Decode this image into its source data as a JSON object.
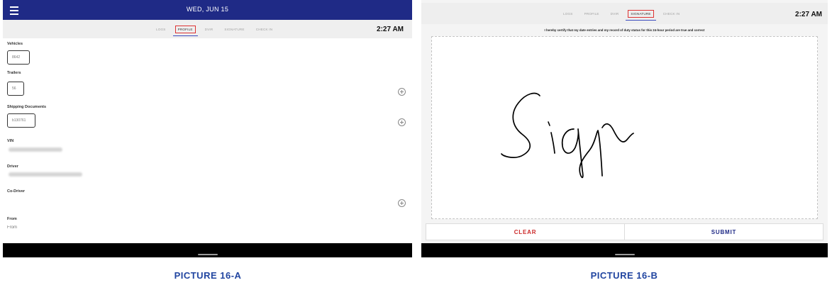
{
  "panel_a": {
    "topbar": {
      "date": "WED, JUN 15",
      "menu_icon": "hamburger-menu-icon",
      "theme_icon": "moon-icon"
    },
    "tabs": [
      {
        "label": "LOGS",
        "active": false
      },
      {
        "label": "PROFILE",
        "active": true
      },
      {
        "label": "DVIR",
        "active": false
      },
      {
        "label": "SIGNATURE",
        "active": false
      },
      {
        "label": "CHECK IN",
        "active": false
      }
    ],
    "time": "2:27 AM",
    "vehicles": {
      "label": "Vehicles",
      "value": "8642"
    },
    "trailers": {
      "label": "Trailers",
      "value": "56"
    },
    "shipping": {
      "label": "Shipping Documents",
      "value": "b130761"
    },
    "vin": {
      "label": "VIN"
    },
    "driver": {
      "label": "Driver"
    },
    "co_driver": {
      "label": "Co-Driver"
    },
    "from": {
      "label": "From",
      "placeholder": "From"
    }
  },
  "panel_b": {
    "tabs": [
      {
        "label": "LOGS",
        "active": false
      },
      {
        "label": "PROFILE",
        "active": false
      },
      {
        "label": "DVIR",
        "active": false
      },
      {
        "label": "SIGNATURE",
        "active": true
      },
      {
        "label": "CHECK IN",
        "active": false
      }
    ],
    "time": "2:27 AM",
    "certification": "I hereby certify that my date entries and my record of duty status for this 24-hour period are true and correct",
    "clear_label": "CLEAR",
    "submit_label": "SUBMIT"
  },
  "captions": {
    "a": "PICTURE 16-A",
    "b": "PICTURE 16-B"
  },
  "colors": {
    "brand_navy": "#1f2a86",
    "clear_red": "#cc2a2a",
    "caption_blue": "#2145a0",
    "active_tab_border": "#dd3333"
  }
}
